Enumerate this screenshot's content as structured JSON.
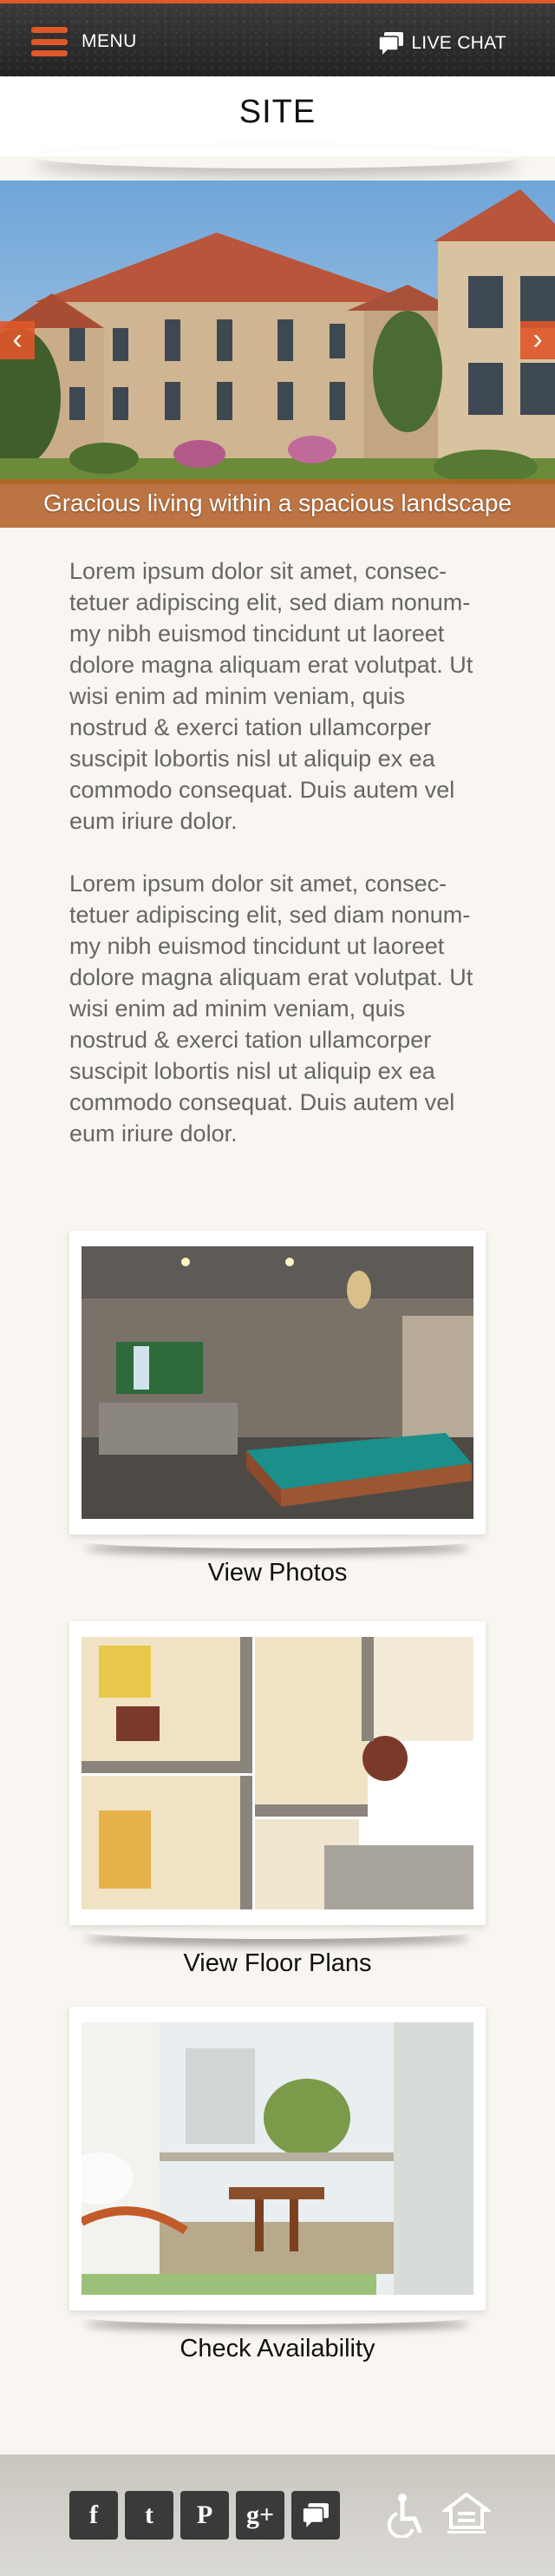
{
  "topbar": {
    "menu_label": "MENU",
    "chat_label": "LIVE CHAT"
  },
  "header": {
    "title": "SITE"
  },
  "hero": {
    "caption": "Gracious living within a spacious landscape",
    "prev_arrow": "‹",
    "next_arrow": "›"
  },
  "content": {
    "paragraphs": [
      "Lorem ipsum dolor sit amet, consec-tetuer adipiscing elit, sed diam nonum-my nibh euismod tincidunt ut laoreet dolore magna aliquam erat volutpat. Ut wisi enim ad minim veniam, quis nostrud & exerci tation ullamcorper suscipit lobortis nisl ut aliquip ex ea commodo consequat. Duis autem vel eum iriure dolor.",
      "Lorem ipsum dolor sit amet, consec-tetuer adipiscing elit, sed diam nonum-my nibh euismod tincidunt ut laoreet dolore magna aliquam erat volutpat. Ut wisi enim ad minim veniam, quis nostrud & exerci tation ullamcorper suscipit lobortis nisl ut aliquip ex ea commodo consequat. Duis autem vel eum iriure dolor."
    ]
  },
  "cards": [
    {
      "label": "View Photos",
      "icon": "living-room-photo"
    },
    {
      "label": "View Floor Plans",
      "icon": "floor-plan-photo"
    },
    {
      "label": "Check Availability",
      "icon": "balcony-photo"
    }
  ],
  "footer": {
    "social": [
      {
        "name": "facebook",
        "glyph": "f"
      },
      {
        "name": "twitter",
        "glyph": "t"
      },
      {
        "name": "pinterest",
        "glyph": "P"
      },
      {
        "name": "google-plus",
        "glyph": "g+"
      },
      {
        "name": "chat",
        "glyph": ""
      }
    ],
    "icons": [
      "accessibility-icon",
      "equal-housing-icon"
    ]
  },
  "colors": {
    "accent": "#e0572a",
    "background": "#f9f6f1",
    "topbar": "#2a2a2a"
  }
}
